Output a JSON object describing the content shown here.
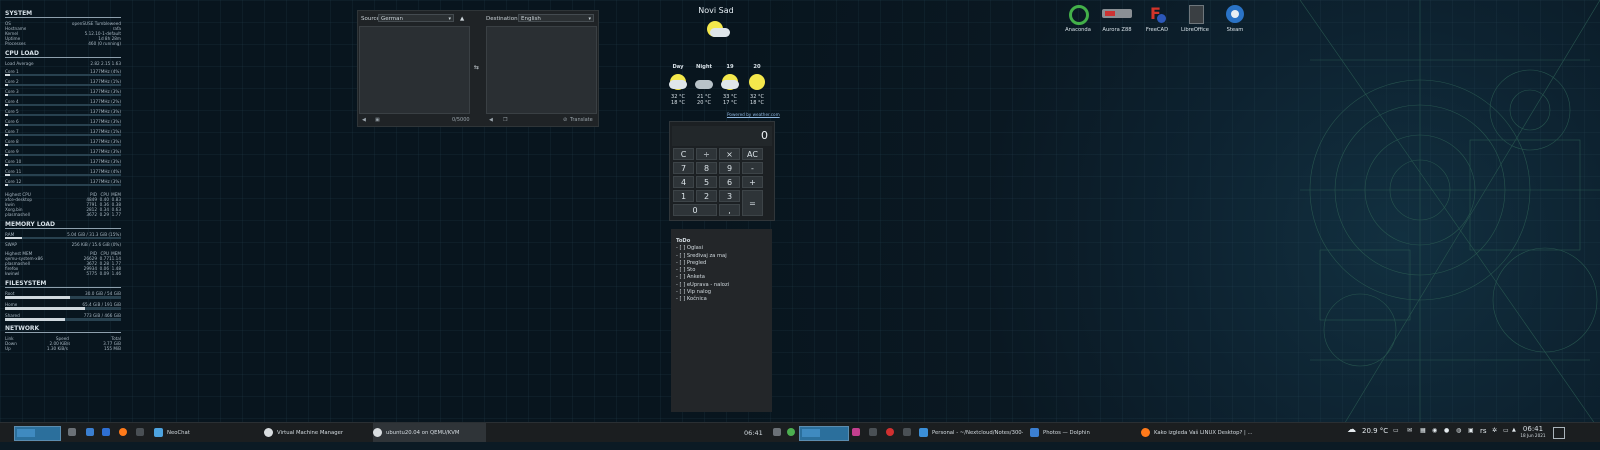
{
  "system_monitor": {
    "system": {
      "title": "SYSTEM",
      "rows": [
        {
          "k": "OS",
          "v": "openSUSE Tumbleweed"
        },
        {
          "k": "Hostname",
          "v": "rafa"
        },
        {
          "k": "Kernel",
          "v": "5.12.10-1-default"
        },
        {
          "k": "Uptime",
          "v": "1d 8h 28m"
        },
        {
          "k": "Processes",
          "v": "460 (0 running)"
        }
      ]
    },
    "cpu": {
      "title": "CPU LOAD",
      "load_label": "Load Average",
      "load_value": "2.82 2.15 1.63",
      "cores": [
        {
          "name": "Core 1",
          "mhz": "1377MHz",
          "pct": "(4%)",
          "fill": 0.04
        },
        {
          "name": "Core 2",
          "mhz": "1377MHz",
          "pct": "(1%)",
          "fill": 0.01
        },
        {
          "name": "Core 3",
          "mhz": "1377MHz",
          "pct": "(3%)",
          "fill": 0.03
        },
        {
          "name": "Core 4",
          "mhz": "1377MHz",
          "pct": "(2%)",
          "fill": 0.02
        },
        {
          "name": "Core 5",
          "mhz": "1377MHz",
          "pct": "(3%)",
          "fill": 0.03
        },
        {
          "name": "Core 6",
          "mhz": "1377MHz",
          "pct": "(3%)",
          "fill": 0.03
        },
        {
          "name": "Core 7",
          "mhz": "1377MHz",
          "pct": "(1%)",
          "fill": 0.01
        },
        {
          "name": "Core 8",
          "mhz": "1377MHz",
          "pct": "(3%)",
          "fill": 0.03
        },
        {
          "name": "Core 9",
          "mhz": "1377MHz",
          "pct": "(3%)",
          "fill": 0.03
        },
        {
          "name": "Core 10",
          "mhz": "1377MHz",
          "pct": "(3%)",
          "fill": 0.03
        },
        {
          "name": "Core 11",
          "mhz": "1377MHz",
          "pct": "(4%)",
          "fill": 0.04
        },
        {
          "name": "Core 12",
          "mhz": "1377MHz",
          "pct": "(3%)",
          "fill": 0.03
        }
      ],
      "top_header": [
        "Highest CPU",
        "PID",
        "CPU",
        "MEM"
      ],
      "top": [
        [
          "xfce-desktop",
          "4849",
          "0.40",
          "0.83"
        ],
        [
          "kwin",
          "7791",
          "0.36",
          "0.38"
        ],
        [
          "Xorg.bin",
          "2812",
          "0.34",
          "0.63"
        ],
        [
          "plasmashell",
          "3672",
          "0.29",
          "1.77"
        ]
      ]
    },
    "memory": {
      "title": "MEMORY LOAD",
      "ram_label": "RAM",
      "ram_value": "5.04 GiB / 31.3 GiB (15%)",
      "ram_fill": 0.15,
      "swap_label": "SWAP",
      "swap_value": "256 KiB / 15.6 GiB (0%)",
      "swap_fill": 0.0,
      "top_header": [
        "Highest MEM",
        "PID",
        "CPU",
        "MEM"
      ],
      "top": [
        [
          "qemu-system-x86",
          "26629",
          "0.77",
          "11.14"
        ],
        [
          "plasmashell",
          "3672",
          "0.28",
          "1.77"
        ],
        [
          "firefox",
          "29934",
          "0.06",
          "1.48"
        ],
        [
          "kwinwl",
          "5775",
          "0.09",
          "1.46"
        ]
      ]
    },
    "filesystem": {
      "title": "FILESYSTEM",
      "mounts": [
        {
          "name": "Root",
          "value": "30.0 GiB / 54 GiB",
          "fill": 0.56
        },
        {
          "name": "Home",
          "value": "65.4 GiB / 191 GiB",
          "fill": 0.69
        },
        {
          "name": "Shared",
          "value": "773 GiB / 466 GiB",
          "fill": 0.52
        }
      ]
    },
    "network": {
      "title": "NETWORK",
      "header": [
        "Link",
        "Speed",
        "Total"
      ],
      "rows": [
        [
          "Down",
          "2.00 KiB/s",
          "3.77 GiB"
        ],
        [
          "Up",
          "1.30 KiB/s",
          "155 MiB"
        ]
      ]
    }
  },
  "translator": {
    "source_label": "Source",
    "source_lang": "German",
    "dest_label": "Destination",
    "dest_lang": "English",
    "swap_symbol": "⇆",
    "char_count": "0/5000",
    "translate_label": "Translate"
  },
  "weather": {
    "city": "Novi Sad",
    "powered": "Powered by weather.com",
    "days": [
      {
        "label": "Day",
        "high": "32 °C",
        "low": "18 °C",
        "icon": "sun-cloud-icon"
      },
      {
        "label": "Night",
        "high": "21 °C",
        "low": "20 °C",
        "icon": "cloud-icon"
      },
      {
        "label": "19",
        "high": "33 °C",
        "low": "17 °C",
        "icon": "sun-cloud-icon"
      },
      {
        "label": "20",
        "high": "32 °C",
        "low": "18 °C",
        "icon": "sun-icon"
      }
    ]
  },
  "calculator": {
    "display": "0",
    "keys": [
      "C",
      "÷",
      "×",
      "AC",
      "7",
      "8",
      "9",
      "-",
      "4",
      "5",
      "6",
      "+",
      "1",
      "2",
      "3",
      "=",
      "0",
      ","
    ]
  },
  "todo": {
    "title": "ToDo",
    "items": [
      "- [ ] Oglasi",
      "- [ ] Sređivaj za maj",
      "- [ ] Pregled",
      "- [ ] Sto",
      "- [ ] Anketa",
      "- [ ] eUprava - nalozi",
      "- [ ] Vip nalog",
      "- [ ] Kočnica"
    ]
  },
  "desktop_icons": [
    "Anaconda",
    "Aurora Z88",
    "FreeCAD",
    "LibreOffice",
    "Steam"
  ],
  "taskbar": {
    "left_tasks": [
      "NeoChat",
      "Virtual Machine Manager",
      "ubuntu20.04 on QEMU/KVM"
    ],
    "clock_left": "06:41",
    "right_tasks": [
      "Personal - ~/Nextcloud/Notes/300-...",
      "Photos — Dolphin",
      "Kako izgleda Vaš LINUX Desktop? | ..."
    ],
    "temperature": "20.9 °C",
    "keyboard": "rs",
    "time": "06:41",
    "date": "18 Jun 2021"
  }
}
